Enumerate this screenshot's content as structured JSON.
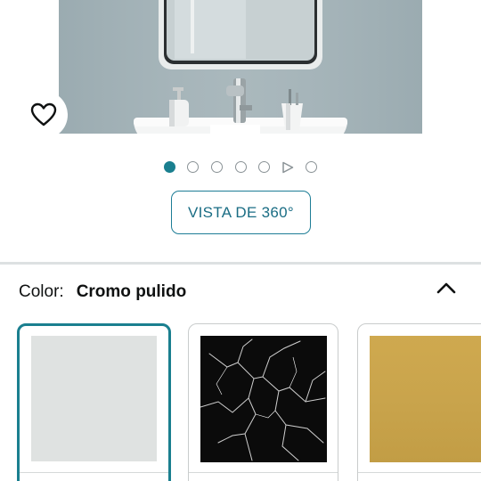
{
  "product": {
    "image_alt": "mirror-above-sink"
  },
  "wishlist": {
    "icon": "heart-outline-icon"
  },
  "carousel": {
    "total_items": 7,
    "active_index": 0,
    "video_index": 5
  },
  "view_360_label": "VISTA DE 360°",
  "color_section": {
    "label": "Color:",
    "selected_value": "Cromo pulido",
    "expanded": true
  },
  "swatches": [
    {
      "name": "Cromo pulido",
      "fill": "#dfe2e1",
      "selected": true
    },
    {
      "name": "Mármol negro",
      "fill": "#0b0b0b",
      "selected": false
    },
    {
      "name": "Dorado",
      "fill": "#c9a44c",
      "selected": false
    }
  ],
  "colors": {
    "accent": "#1a7f8f",
    "link_text": "#1a6d84",
    "divider": "#dde1e2"
  }
}
